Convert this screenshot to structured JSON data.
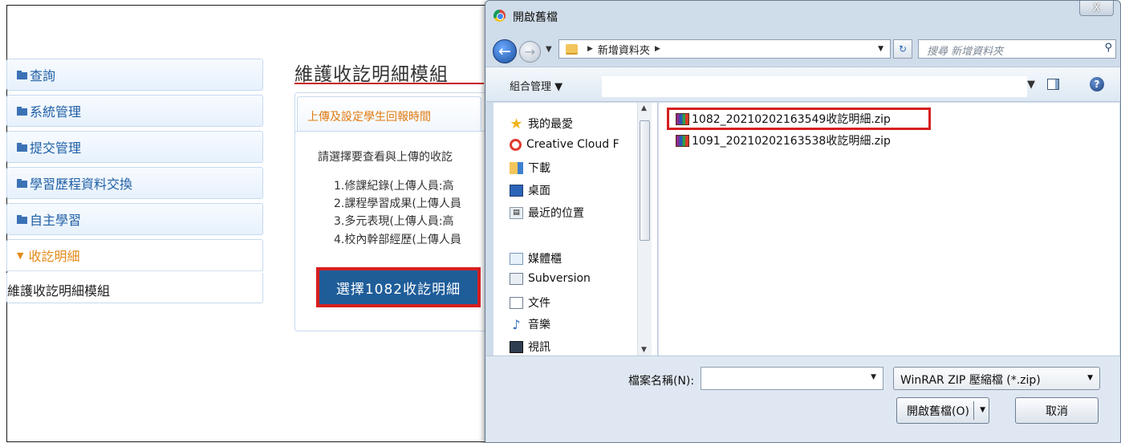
{
  "sidebar": {
    "items": [
      {
        "label": "查詢"
      },
      {
        "label": "系統管理"
      },
      {
        "label": "提交管理"
      },
      {
        "label": "學習歷程資料交換"
      },
      {
        "label": "自主學習"
      },
      {
        "label": "收訖明細",
        "expanded": true,
        "children": [
          "維護收訖明細模組"
        ]
      }
    ]
  },
  "main": {
    "title": "維護收訖明細模組",
    "tab_label": "上傳及設定學生回報時間",
    "description": "請選擇要查看與上傳的收訖",
    "list": [
      "1.修課紀錄(上傳人員:高",
      "2.課程學習成果(上傳人員",
      "3.多元表現(上傳人員:高",
      "4.校內幹部經歷(上傳人員"
    ],
    "select_button": "選擇1082收訖明細"
  },
  "dialog": {
    "title": "開啟舊檔",
    "close_icon": "X",
    "address": {
      "path": "新增資料夾"
    },
    "search_placeholder": "搜尋 新增資料夾",
    "toolbar": {
      "organize": "組合管理 ▼"
    },
    "nav": [
      {
        "label": "我的最愛",
        "icon": "star-icon"
      },
      {
        "label": "Creative Cloud F",
        "icon": "creative-cloud-icon"
      },
      {
        "label": "下載",
        "icon": "downloads-icon"
      },
      {
        "label": "桌面",
        "icon": "desktop-icon"
      },
      {
        "label": "最近的位置",
        "icon": "recent-places-icon"
      },
      {
        "label": "媒體櫃",
        "icon": "library-icon"
      },
      {
        "label": "Subversion",
        "icon": "subversion-icon"
      },
      {
        "label": "文件",
        "icon": "documents-icon"
      },
      {
        "label": "音樂",
        "icon": "music-icon"
      },
      {
        "label": "視訊",
        "icon": "video-icon"
      }
    ],
    "files": [
      {
        "name": "1082_20210202163549收訖明細.zip",
        "highlighted": true
      },
      {
        "name": "1091_20210202163538收訖明細.zip",
        "highlighted": false
      }
    ],
    "filename_label": "檔案名稱(N):",
    "filename_value": "",
    "filter": "WinRAR ZIP 壓縮檔 (*.zip)",
    "open_button": "開啟舊檔(O)",
    "cancel_button": "取消"
  },
  "colors": {
    "sidebar_text": "#1f5fa5",
    "active_orange": "#e48a18",
    "select_button_bg": "#1f5d99",
    "highlight_red": "#d61f1f"
  }
}
